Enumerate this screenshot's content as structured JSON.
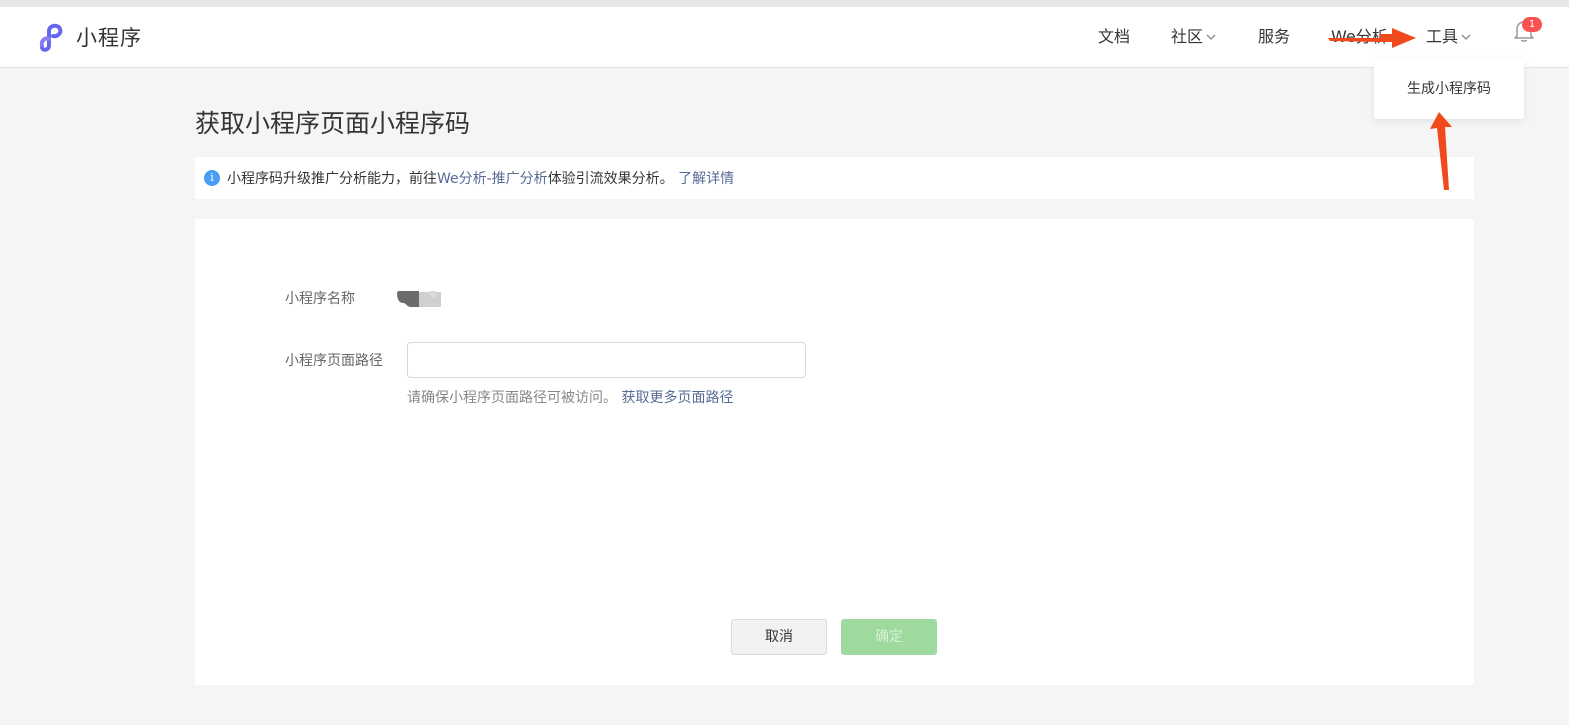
{
  "app": {
    "logo_icon": "miniprogram-logo-icon",
    "logo_text": "小程序"
  },
  "nav": {
    "items": [
      {
        "label": "文档",
        "has_dropdown": false
      },
      {
        "label": "社区",
        "has_dropdown": true
      },
      {
        "label": "服务",
        "has_dropdown": false
      },
      {
        "label": "We分析",
        "has_dropdown": false
      },
      {
        "label": "工具",
        "has_dropdown": true
      }
    ],
    "notification_icon": "bell-icon",
    "notification_count": "1"
  },
  "tools_dropdown": {
    "items": [
      {
        "label": "生成小程序码"
      }
    ]
  },
  "page": {
    "title": "获取小程序页面小程序码"
  },
  "notice": {
    "icon": "info-icon",
    "text_before": "小程序码升级推广分析能力，前往",
    "link_analysis": "We分析-推广分析",
    "text_after": "体验引流效果分析。 ",
    "link_more": "了解详情"
  },
  "form": {
    "name_label": "小程序名称",
    "name_value_icon": "redacted-name-image",
    "path_label": "小程序页面路径",
    "path_value": "",
    "path_placeholder": "",
    "hint_text": "请确保小程序页面路径可被访问。 ",
    "hint_link": "获取更多页面路径"
  },
  "actions": {
    "cancel_label": "取消",
    "confirm_label": "确定"
  },
  "colors": {
    "link": "#576b95",
    "brand_logo": "#6467f0",
    "confirm_disabled": "#9ed99d",
    "badge": "#fa5151",
    "annotation_arrow": "#f04a1c"
  }
}
